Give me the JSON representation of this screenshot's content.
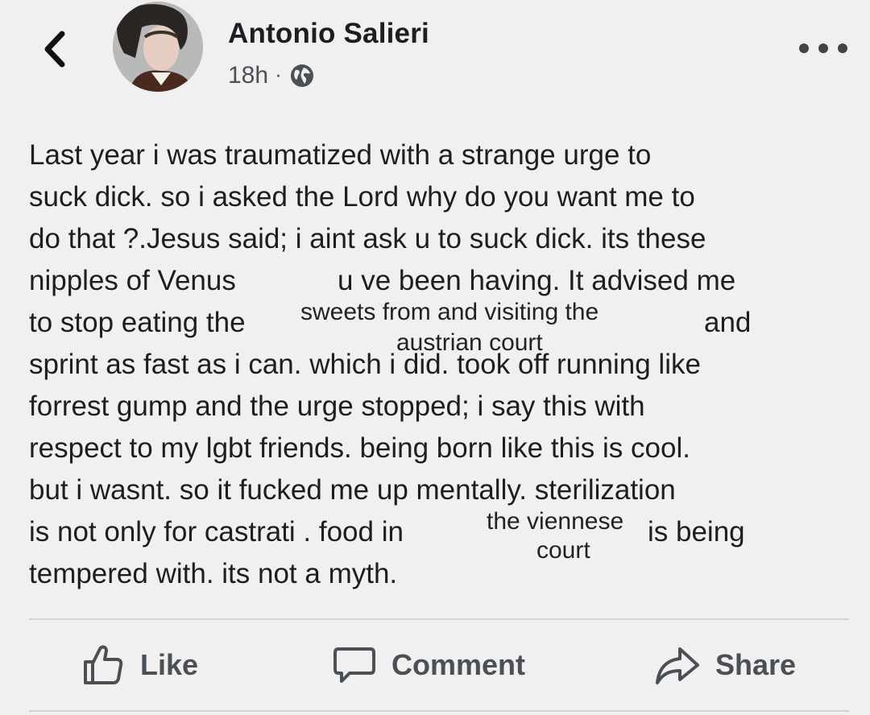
{
  "header": {
    "author_name": "Antonio Salieri",
    "timestamp": "18h",
    "separator": "·",
    "audience_icon": "globe-icon",
    "back_icon": "chevron-left-icon",
    "more_icon": "more-dots-icon"
  },
  "post": {
    "lines": [
      "Last year i was traumatized with a strange urge to",
      "suck dick. so  i asked the Lord  why do you want me to",
      "do that ?.Jesus said; i aint ask u to suck dick. its these",
      "nipples of Venus",
      "u ve been having. It advised me",
      "to stop eating the",
      "and",
      "sprint as fast as i can. which i did. took off running like",
      "forrest gump and the urge stopped;  i say this with",
      "respect to my lgbt friends. being born like this is cool.",
      "but i wasnt. so it fucked me up mentally. sterilization",
      "is not only for castrati  . food in",
      "is being",
      "tempered with. its not a myth."
    ],
    "insets": {
      "sweets_line1": "sweets from and visiting the",
      "sweets_line2": "austrian court",
      "viennese_line1": "the viennese",
      "viennese_line2": "court"
    }
  },
  "actions": {
    "like": {
      "label": "Like",
      "icon": "thumbs-up-icon"
    },
    "comment": {
      "label": "Comment",
      "icon": "speech-bubble-icon"
    },
    "share": {
      "label": "Share",
      "icon": "share-arrow-icon"
    }
  },
  "colors": {
    "background": "#f0f0f0",
    "text": "#1c1e21",
    "secondary_text": "#4b4f56",
    "divider": "#d3d3d3"
  }
}
